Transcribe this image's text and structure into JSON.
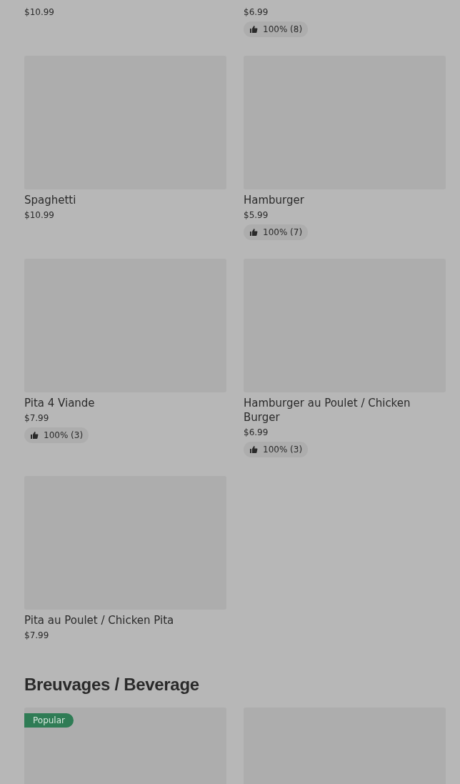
{
  "items": [
    {
      "kind": "cut",
      "price": "$10.99"
    },
    {
      "kind": "cut",
      "price": "$6.99",
      "rating": "100% (8)"
    },
    {
      "kind": "card",
      "name": "Spaghetti",
      "price": "$10.99"
    },
    {
      "kind": "card",
      "name": "Hamburger",
      "price": "$5.99",
      "rating": "100% (7)"
    },
    {
      "kind": "card",
      "name": "Pita 4 Viande",
      "price": "$7.99",
      "rating": "100% (3)"
    },
    {
      "kind": "card",
      "name": "Hamburger au Poulet / Chicken Burger",
      "price": "$6.99",
      "rating": "100% (3)"
    },
    {
      "kind": "card",
      "name": "Pita au Poulet / Chicken Pita",
      "price": "$7.99"
    }
  ],
  "section": {
    "title": "Breuvages / Beverage",
    "items": [
      {
        "kind": "card",
        "badge": "Popular"
      },
      {
        "kind": "card"
      }
    ]
  }
}
